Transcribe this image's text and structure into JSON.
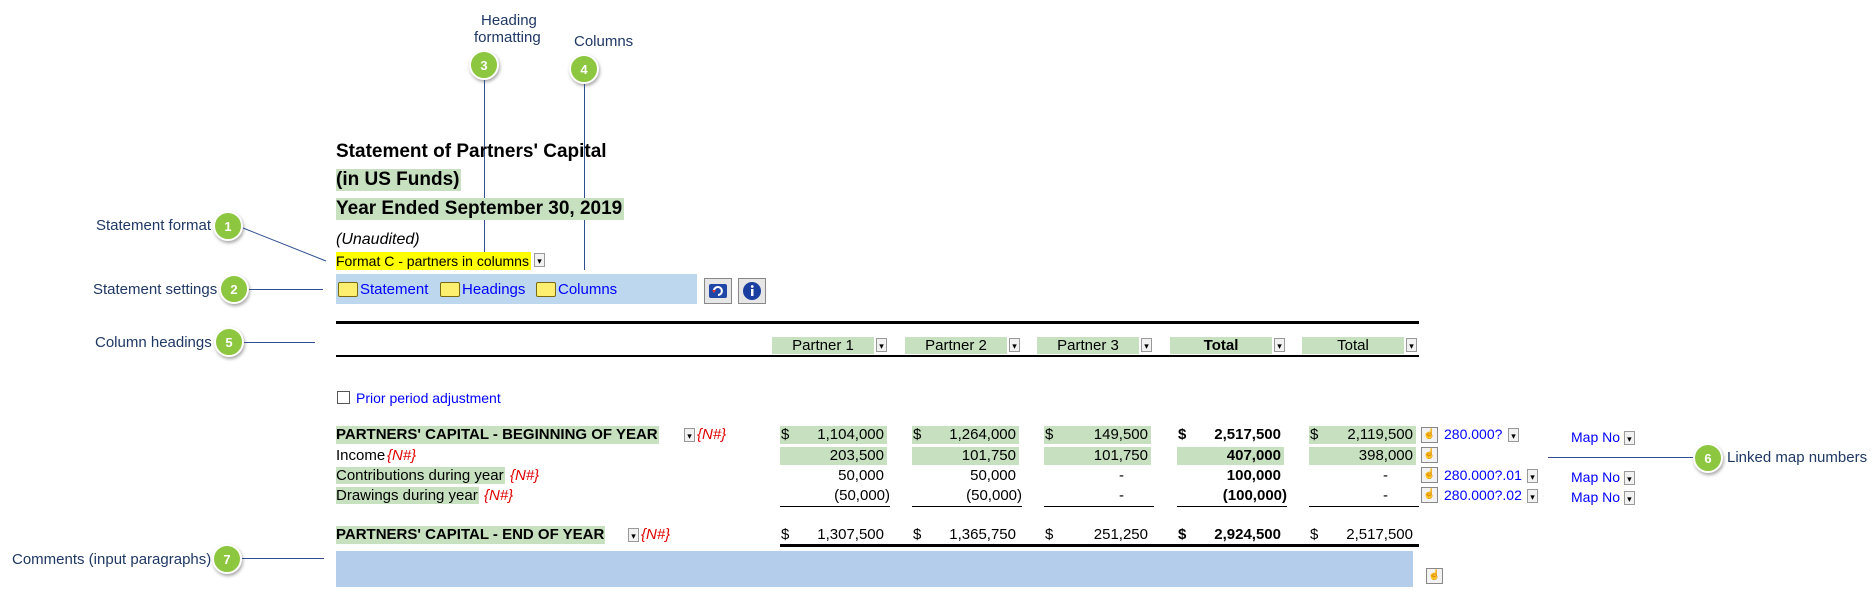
{
  "callouts": {
    "c1": {
      "num": "1",
      "label": "Statement format"
    },
    "c2": {
      "num": "2",
      "label": "Statement settings"
    },
    "c3": {
      "num": "3",
      "label_line1": "Heading",
      "label_line2": "formatting"
    },
    "c4": {
      "num": "4",
      "label": "Columns"
    },
    "c5": {
      "num": "5",
      "label": "Column headings"
    },
    "c6": {
      "num": "6",
      "label": "Linked map numbers"
    },
    "c7": {
      "num": "7",
      "label": "Comments (input paragraphs)"
    }
  },
  "statement": {
    "title": "Statement of Partners' Capital",
    "subtitle1": "(in US Funds)",
    "subtitle2": "Year Ended September 30, 2019",
    "unaudited": "(Unaudited)",
    "format_value": "Format C - partners in columns"
  },
  "settings": {
    "statement": "Statement",
    "headings": "Headings",
    "columns": "Columns",
    "refresh_icon": "refresh-icon",
    "info_icon": "info-icon"
  },
  "column_headers": [
    "Partner 1",
    "Partner 2",
    "Partner 3",
    "Total",
    "Total"
  ],
  "prior_period": "Prior period adjustment",
  "n_marker": "{N#}",
  "currency": "$",
  "rows": {
    "beginning": {
      "label": "PARTNERS' CAPITAL - BEGINNING OF YEAR",
      "values": [
        "1,104,000",
        "1,264,000",
        "149,500",
        "2,517,500",
        "2,119,500"
      ],
      "map": "280.000?",
      "map_label": "Map No"
    },
    "income": {
      "label": "Income",
      "values": [
        "203,500",
        "101,750",
        "101,750",
        "407,000",
        "398,000"
      ]
    },
    "contributions": {
      "label": "Contributions during year",
      "values": [
        "50,000",
        "50,000",
        "-",
        "100,000",
        "-"
      ],
      "map": "280.000?.01",
      "map_label": "Map No"
    },
    "drawings": {
      "label": "Drawings during year",
      "values": [
        "(50,000)",
        "(50,000)",
        "-",
        "(100,000)",
        "-"
      ],
      "map": "280.000?.02",
      "map_label": "Map No"
    },
    "ending": {
      "label": "PARTNERS' CAPITAL - END OF YEAR",
      "values": [
        "1,307,500",
        "1,365,750",
        "251,250",
        "2,924,500",
        "2,517,500"
      ]
    }
  },
  "colors": {
    "accent_green": "#8dc63f",
    "fill_green": "#c6e0c0",
    "settings_blue": "#bdd7ee",
    "format_yellow": "#ffff00"
  }
}
